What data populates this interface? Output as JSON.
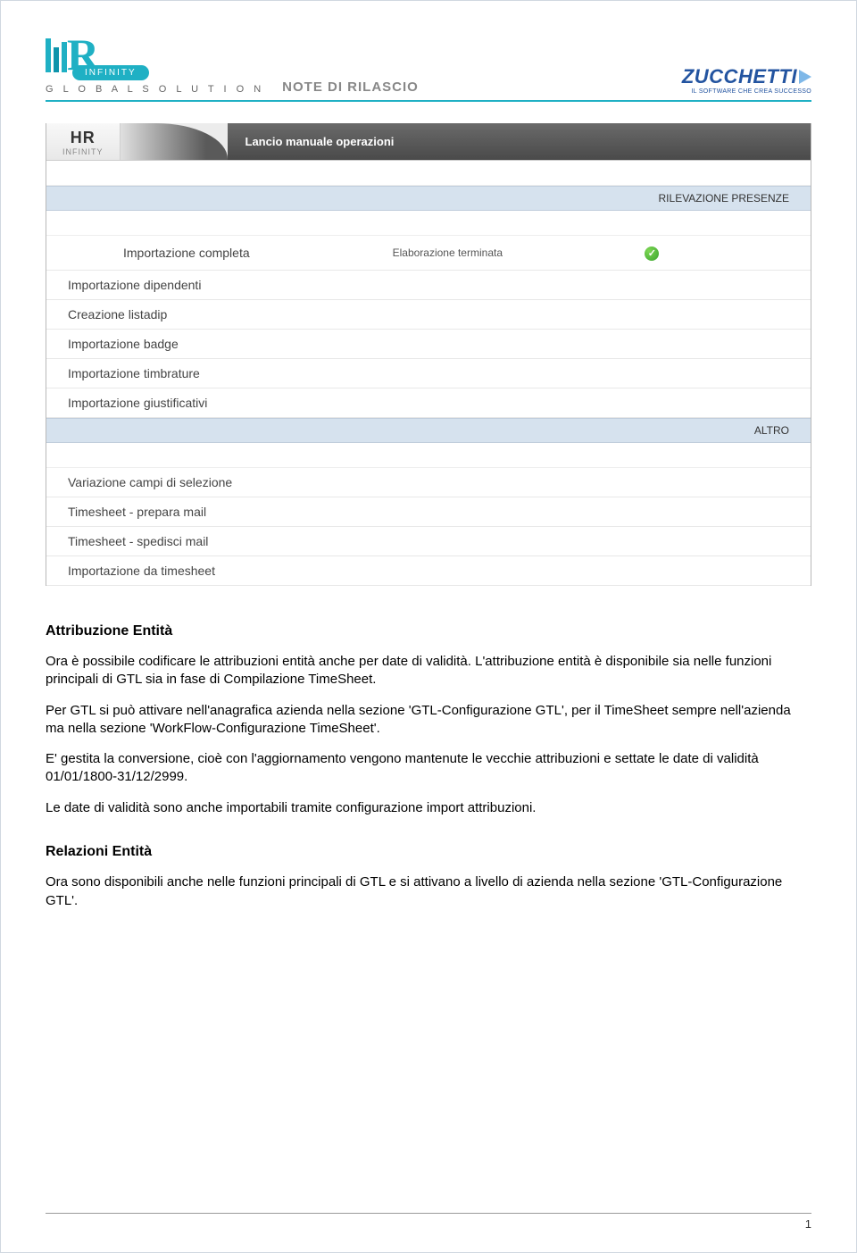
{
  "doc_header": {
    "logo_infinity": "INFINITY",
    "logo_tagline": "G L O B A L   S O L U T I O N",
    "title": "NOTE DI RILASCIO",
    "vendor_name": "ZUCCHETTI",
    "vendor_tagline": "IL SOFTWARE CHE CREA SUCCESSO"
  },
  "screenshot": {
    "brand_hr": "HR",
    "brand_sub": "INFINITY",
    "titlebar": "Lancio manuale operazioni",
    "section1_header": "RILEVAZIONE PRESENZE",
    "status_row": {
      "label": "Importazione completa",
      "message": "Elaborazione terminata"
    },
    "section1_rows": [
      "Importazione dipendenti",
      "Creazione listadip",
      "Importazione badge",
      "Importazione timbrature",
      "Importazione giustificativi"
    ],
    "section2_header": "ALTRO",
    "section2_rows": [
      "Variazione campi di selezione",
      "Timesheet - prepara mail",
      "Timesheet - spedisci mail",
      "Importazione da timesheet"
    ]
  },
  "content": {
    "h1": "Attribuzione Entità",
    "p1": "Ora è possibile codificare le attribuzioni entità anche per date di validità. L'attribuzione entità è disponibile sia nelle funzioni principali di GTL sia in fase di Compilazione TimeSheet.",
    "p2": "Per GTL si può attivare nell'anagrafica azienda nella sezione 'GTL-Configurazione GTL', per il TimeSheet sempre nell'azienda ma nella sezione 'WorkFlow-Configurazione TimeSheet'.",
    "p3": "E' gestita la conversione, cioè con l'aggiornamento vengono mantenute le vecchie attribuzioni e settate le date di validità 01/01/1800-31/12/2999.",
    "p4": "Le date di validità sono anche importabili tramite configurazione import attribuzioni.",
    "h2": "Relazioni Entità",
    "p5": "Ora sono disponibili anche nelle funzioni principali di GTL e si attivano a livello di azienda nella sezione 'GTL-Configurazione GTL'."
  },
  "page_number": "1"
}
